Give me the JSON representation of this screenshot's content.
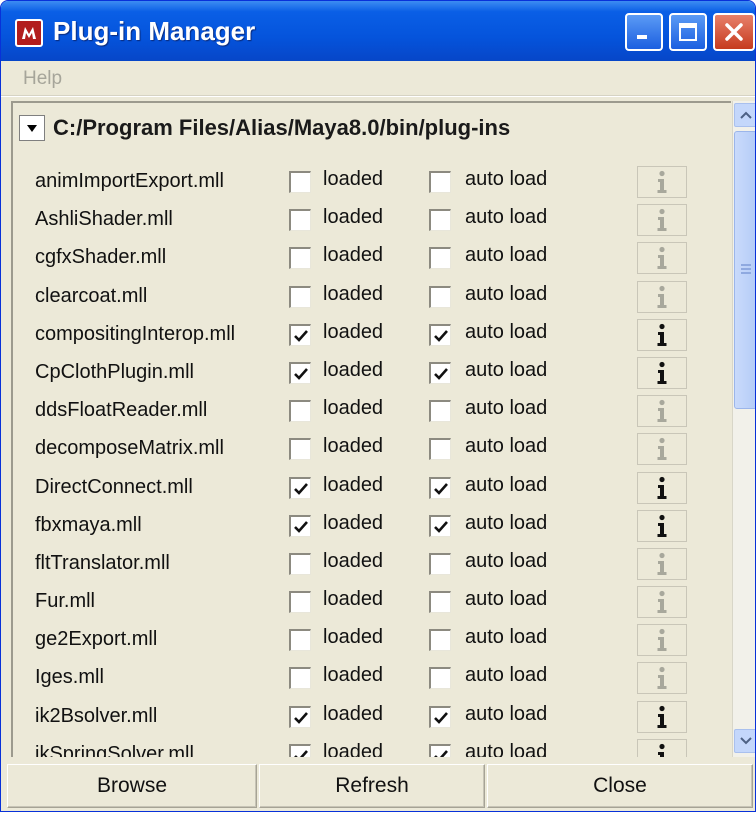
{
  "window": {
    "title": "Plug-in Manager",
    "title_icon": "maya-logo-icon",
    "controls": [
      "minimize-icon",
      "maximize-icon",
      "close-icon"
    ]
  },
  "menu": {
    "help_label": "Help"
  },
  "path": "C:/Program Files/Alias/Maya8.0/bin/plug-ins",
  "labels": {
    "loaded": "loaded",
    "auto_load": "auto load"
  },
  "plugins": [
    {
      "name": "animImportExport.mll",
      "loaded": false,
      "auto_load": false
    },
    {
      "name": "AshliShader.mll",
      "loaded": false,
      "auto_load": false
    },
    {
      "name": "cgfxShader.mll",
      "loaded": false,
      "auto_load": false
    },
    {
      "name": "clearcoat.mll",
      "loaded": false,
      "auto_load": false
    },
    {
      "name": "compositingInterop.mll",
      "loaded": true,
      "auto_load": true
    },
    {
      "name": "CpClothPlugin.mll",
      "loaded": true,
      "auto_load": true
    },
    {
      "name": "ddsFloatReader.mll",
      "loaded": false,
      "auto_load": false
    },
    {
      "name": "decomposeMatrix.mll",
      "loaded": false,
      "auto_load": false
    },
    {
      "name": "DirectConnect.mll",
      "loaded": true,
      "auto_load": true
    },
    {
      "name": "fbxmaya.mll",
      "loaded": true,
      "auto_load": true
    },
    {
      "name": "fltTranslator.mll",
      "loaded": false,
      "auto_load": false
    },
    {
      "name": "Fur.mll",
      "loaded": false,
      "auto_load": false
    },
    {
      "name": "ge2Export.mll",
      "loaded": false,
      "auto_load": false
    },
    {
      "name": "Iges.mll",
      "loaded": false,
      "auto_load": false
    },
    {
      "name": "ik2Bsolver.mll",
      "loaded": true,
      "auto_load": true
    },
    {
      "name": "ikSpringSolver.mll",
      "loaded": true,
      "auto_load": true
    }
  ],
  "buttons": {
    "browse": "Browse",
    "refresh": "Refresh",
    "close": "Close"
  },
  "colors": {
    "titlebar": "#0554dc",
    "window_bg": "#ece9d8",
    "info_active": "#111111",
    "info_inactive": "#a8a89c"
  }
}
